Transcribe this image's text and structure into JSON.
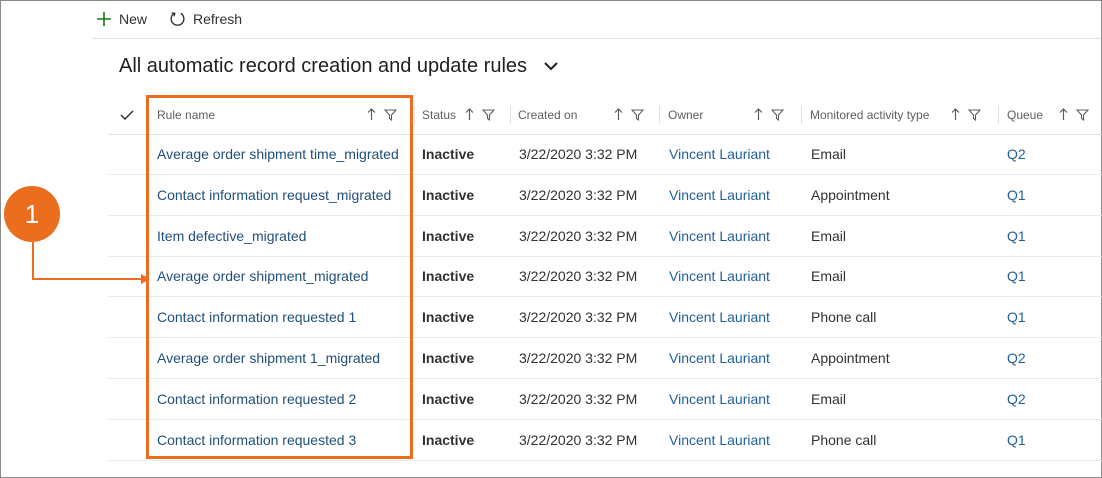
{
  "toolbar": {
    "new_label": "New",
    "refresh_label": "Refresh"
  },
  "view": {
    "title": "All automatic record creation and update rules"
  },
  "columns": [
    {
      "label": "Rule name"
    },
    {
      "label": "Status"
    },
    {
      "label": "Created on"
    },
    {
      "label": "Owner"
    },
    {
      "label": "Monitored activity type"
    },
    {
      "label": "Queue"
    }
  ],
  "rows": [
    {
      "name": "Average order shipment time_migrated",
      "status": "Inactive",
      "created": "3/22/2020 3:32 PM",
      "owner": "Vincent Lauriant",
      "type": "Email",
      "queue": "Q2"
    },
    {
      "name": "Contact information request_migrated",
      "status": "Inactive",
      "created": "3/22/2020 3:32 PM",
      "owner": "Vincent Lauriant",
      "type": "Appointment",
      "queue": "Q1"
    },
    {
      "name": "Item defective_migrated",
      "status": "Inactive",
      "created": "3/22/2020 3:32 PM",
      "owner": "Vincent Lauriant",
      "type": "Email",
      "queue": "Q1"
    },
    {
      "name": "Average order shipment_migrated",
      "status": "Inactive",
      "created": "3/22/2020 3:32 PM",
      "owner": "Vincent Lauriant",
      "type": "Email",
      "queue": "Q1"
    },
    {
      "name": "Contact information requested 1",
      "status": "Inactive",
      "created": "3/22/2020 3:32 PM",
      "owner": "Vincent Lauriant",
      "type": "Phone call",
      "queue": "Q1"
    },
    {
      "name": "Average order shipment 1_migrated",
      "status": "Inactive",
      "created": "3/22/2020 3:32 PM",
      "owner": "Vincent Lauriant",
      "type": "Appointment",
      "queue": "Q2"
    },
    {
      "name": "Contact information requested 2",
      "status": "Inactive",
      "created": "3/22/2020 3:32 PM",
      "owner": "Vincent Lauriant",
      "type": "Email",
      "queue": "Q2"
    },
    {
      "name": "Contact information requested 3",
      "status": "Inactive",
      "created": "3/22/2020 3:32 PM",
      "owner": "Vincent Lauriant",
      "type": "Phone call",
      "queue": "Q1"
    }
  ],
  "annotation": {
    "number": "1"
  },
  "colors": {
    "accent": "#eb6e1f",
    "link": "#1f5f9b",
    "new_icon": "#107c10"
  },
  "icons": {
    "new": "plus-icon",
    "refresh": "refresh-icon",
    "view_selector": "chevron-down-icon",
    "select_all": "checkmark-icon",
    "sort": "sort-arrow-icon",
    "filter": "filter-icon"
  }
}
